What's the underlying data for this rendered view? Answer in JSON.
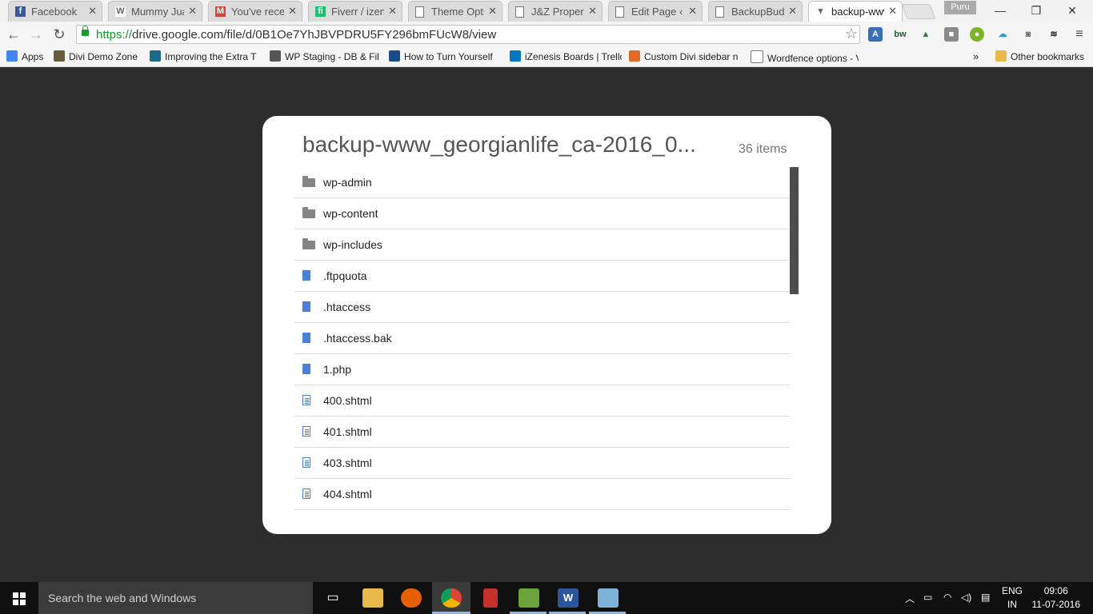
{
  "browser": {
    "tabs": [
      {
        "title": "Facebook",
        "icon": "facebook-icon",
        "icon_char": "f",
        "icon_color": "#3b5998",
        "active": false
      },
      {
        "title": "Mummy Juan",
        "icon": "wikipedia-icon",
        "icon_char": "W",
        "icon_color": "#ffffff",
        "active": false
      },
      {
        "title": "You've receiv",
        "icon": "gmail-icon",
        "icon_char": "M",
        "icon_color": "#d14836",
        "active": false
      },
      {
        "title": "Fiverr / izene",
        "icon": "fiverr-icon",
        "icon_char": "fi",
        "icon_color": "#1dbf73",
        "active": false
      },
      {
        "title": "Theme Optic",
        "icon": "page-icon",
        "icon_char": "",
        "icon_color": "#ffffff",
        "active": false
      },
      {
        "title": "J&Z Property",
        "icon": "page-icon",
        "icon_char": "",
        "icon_color": "#ffffff",
        "active": false
      },
      {
        "title": "Edit Page ‹ B",
        "icon": "page-icon",
        "icon_char": "",
        "icon_color": "#ffffff",
        "active": false
      },
      {
        "title": "BackupBudd",
        "icon": "page-icon",
        "icon_char": "",
        "icon_color": "#ffffff",
        "active": false
      },
      {
        "title": "backup-www",
        "icon": "drive-icon",
        "icon_char": "▾",
        "icon_color": "#ffffff",
        "active": true
      }
    ],
    "profile_name": "Puru",
    "window_controls": {
      "minimize": "—",
      "restore": "❐",
      "close": "✕"
    },
    "url_scheme": "https://",
    "url_rest": "drive.google.com/file/d/0B1Oe7YhJBVPDRU5FY296bmFUcW8/view",
    "bookmarks": [
      {
        "label": "Apps",
        "icon": "apps-grid-icon"
      },
      {
        "label": "Divi Demo Zone",
        "icon": "divi-icon"
      },
      {
        "label": "Improving the Extra T",
        "icon": "extra-icon"
      },
      {
        "label": "WP Staging - DB & Fil",
        "icon": "wordpress-icon"
      },
      {
        "label": "How to Turn Yourself",
        "icon": "h-icon"
      },
      {
        "label": "iZenesis Boards | Trello",
        "icon": "trello-icon"
      },
      {
        "label": "Custom Divi sidebar n",
        "icon": "divi-space-icon"
      },
      {
        "label": "Wordfence options - V",
        "icon": "page-icon"
      }
    ],
    "bookmarks_more": "»",
    "other_bookmarks": "Other bookmarks"
  },
  "viewer": {
    "title": "backup-www_georgianlife_ca-2016_0...",
    "count": "36 items",
    "items": [
      {
        "name": "wp-admin",
        "type": "folder"
      },
      {
        "name": "wp-content",
        "type": "folder"
      },
      {
        "name": "wp-includes",
        "type": "folder"
      },
      {
        "name": ".ftpquota",
        "type": "file"
      },
      {
        "name": ".htaccess",
        "type": "file"
      },
      {
        "name": ".htaccess.bak",
        "type": "file"
      },
      {
        "name": "1.php",
        "type": "file"
      },
      {
        "name": "400.shtml",
        "type": "doc"
      },
      {
        "name": "401.shtml",
        "type": "doc"
      },
      {
        "name": "403.shtml",
        "type": "doc"
      },
      {
        "name": "404.shtml",
        "type": "doc"
      }
    ]
  },
  "taskbar": {
    "search_placeholder": "Search the web and Windows",
    "lang_top": "ENG",
    "lang_bottom": "IN",
    "time": "09:06",
    "date": "11-07-2016"
  },
  "colors": {
    "page_background": "#2d2d2d",
    "file_icon": "#4a80d6",
    "folder_icon": "#858585",
    "secure_green": "#179a2e"
  }
}
